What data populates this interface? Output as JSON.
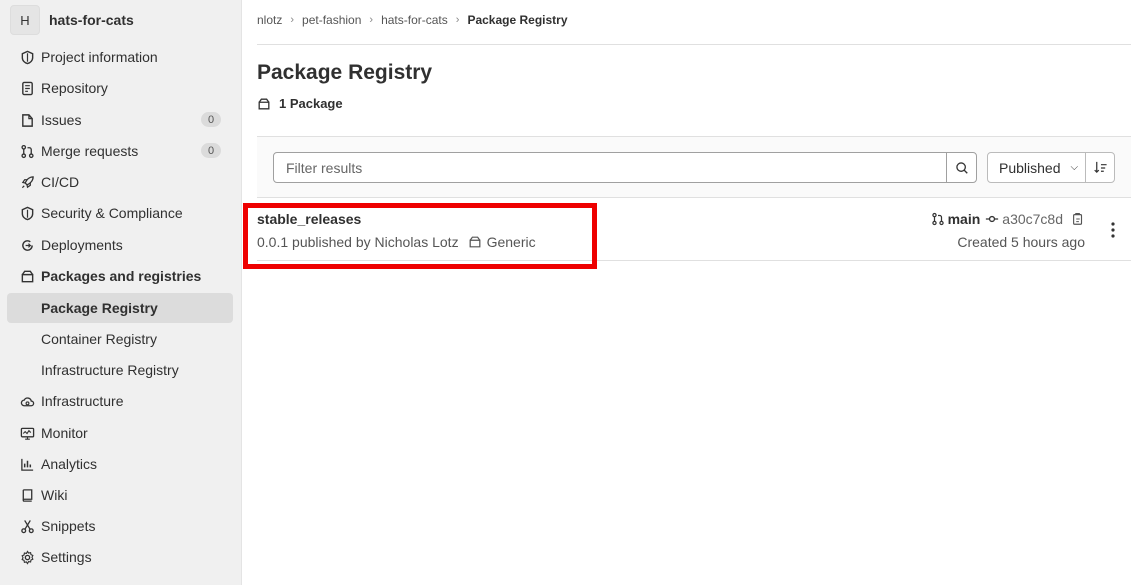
{
  "project": {
    "avatar_letter": "H",
    "name": "hats-for-cats"
  },
  "sidebar": {
    "items": [
      {
        "label": "Project information",
        "icon": "project-information-icon"
      },
      {
        "label": "Repository",
        "icon": "repository-icon"
      },
      {
        "label": "Issues",
        "icon": "issues-icon",
        "count": "0"
      },
      {
        "label": "Merge requests",
        "icon": "merge-request-icon",
        "count": "0"
      },
      {
        "label": "CI/CD",
        "icon": "rocket-icon"
      },
      {
        "label": "Security & Compliance",
        "icon": "shield-icon"
      },
      {
        "label": "Deployments",
        "icon": "deployments-icon"
      },
      {
        "label": "Packages and registries",
        "icon": "package-icon"
      },
      {
        "label": "Package Registry",
        "active": true
      },
      {
        "label": "Container Registry"
      },
      {
        "label": "Infrastructure Registry"
      },
      {
        "label": "Infrastructure",
        "icon": "cloud-gear-icon"
      },
      {
        "label": "Monitor",
        "icon": "monitor-icon"
      },
      {
        "label": "Analytics",
        "icon": "analytics-icon"
      },
      {
        "label": "Wiki",
        "icon": "book-icon"
      },
      {
        "label": "Snippets",
        "icon": "scissors-icon"
      },
      {
        "label": "Settings",
        "icon": "gear-icon"
      }
    ]
  },
  "breadcrumb": [
    "nlotz",
    "pet-fashion",
    "hats-for-cats",
    "Package Registry"
  ],
  "page": {
    "title": "Package Registry",
    "package_count": "1 Package"
  },
  "filter": {
    "placeholder": "Filter results",
    "sort_label": "Published"
  },
  "packages": [
    {
      "name": "stable_releases",
      "meta": "0.0.1 published by Nicholas Lotz",
      "type": "Generic",
      "branch": "main",
      "commit": "a30c7c8d",
      "created": "Created 5 hours ago"
    }
  ],
  "colors": {
    "highlight": "#ee0000",
    "sidebar_bg": "#f0f0f0",
    "active_item_bg": "#dcdcdc"
  }
}
